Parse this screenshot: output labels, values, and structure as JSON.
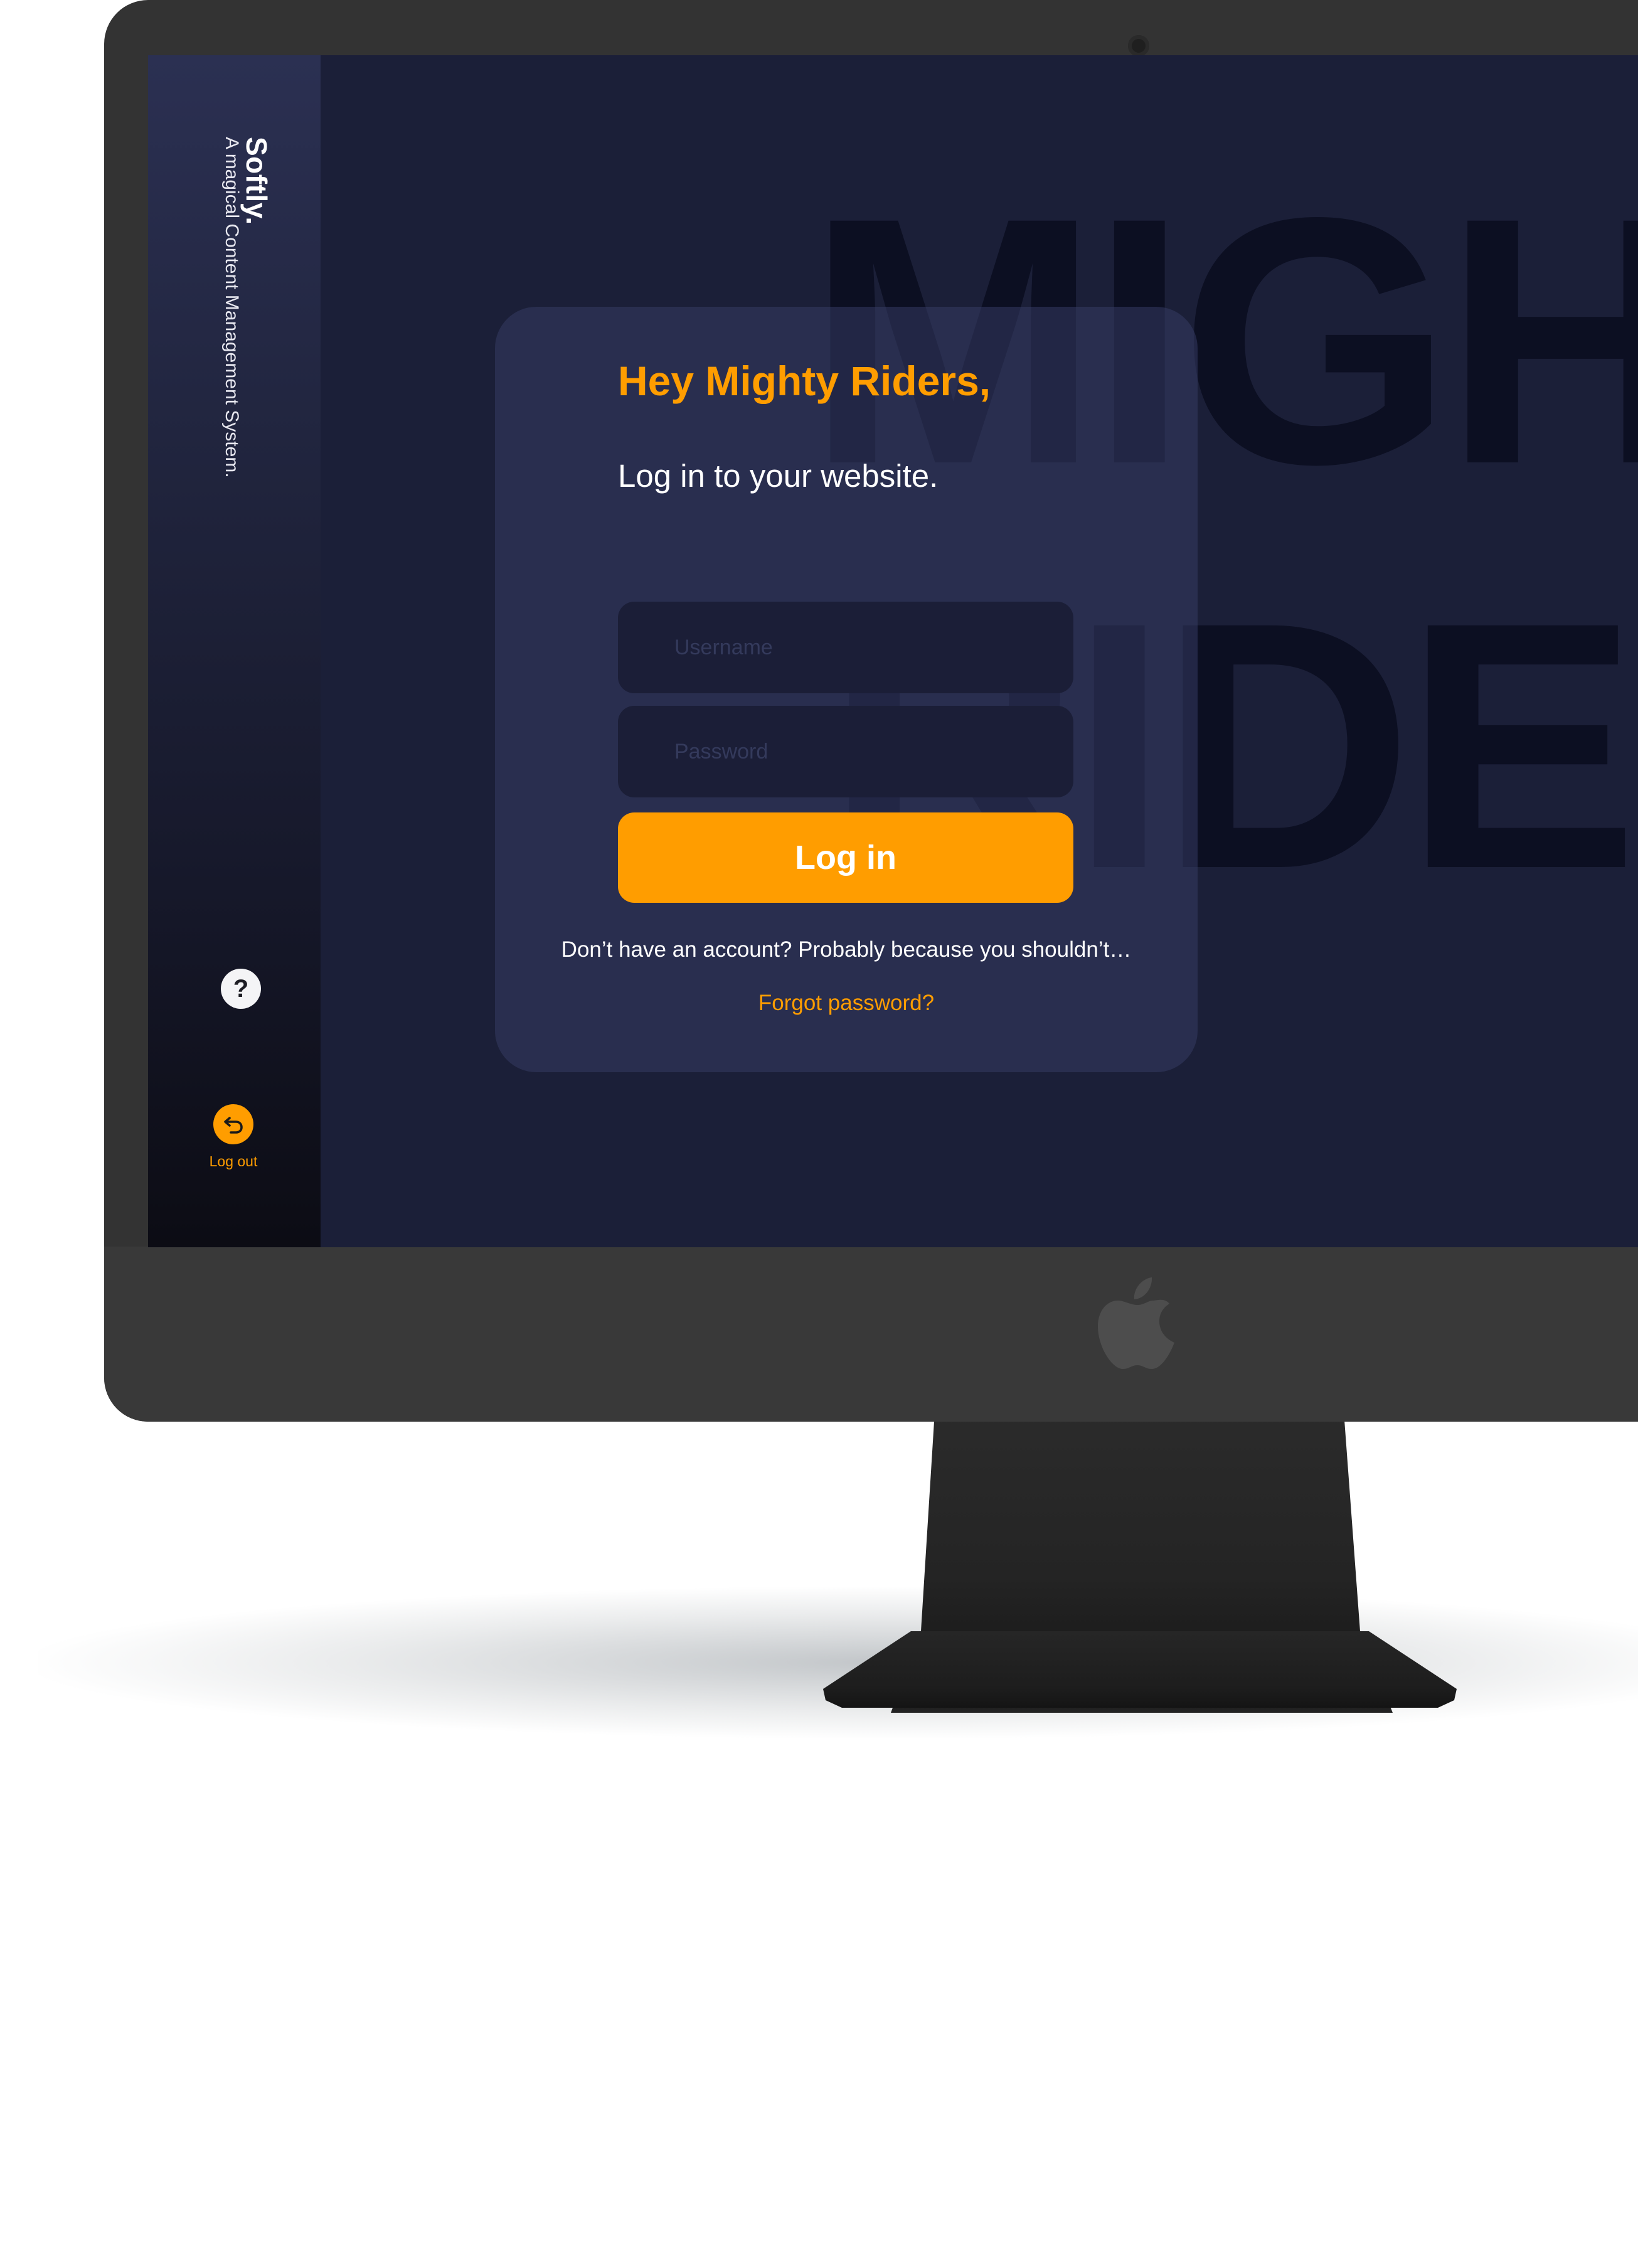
{
  "sidebar": {
    "brand_name": "Softly.",
    "tagline": "A magical Content Management System.",
    "help_symbol": "?",
    "help_icon": "question-mark-icon",
    "logout_icon": "logout-arrow-icon",
    "logout_label": "Log out"
  },
  "background": {
    "word_top": "MIGHT",
    "word_bottom": "RIDER"
  },
  "login": {
    "greeting": "Hey Mighty Riders,",
    "subtitle": "Log in to your website.",
    "username_placeholder": "Username",
    "password_placeholder": "Password",
    "submit_label": "Log in",
    "signup_note": "Don’t have an account? Probably because you shouldn’t…",
    "forgot_link": "Forgot password?"
  },
  "colors": {
    "accent": "#ff9d00",
    "screen_background": "#1b1f38",
    "card_background": "#2c3153",
    "bezel": "#333333"
  }
}
